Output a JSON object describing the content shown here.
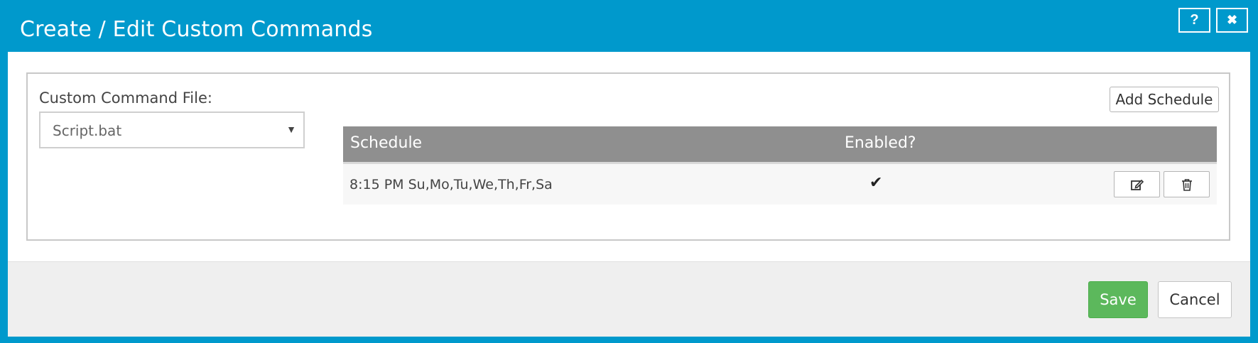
{
  "dialog": {
    "title": "Create / Edit Custom Commands",
    "help_icon": "question-icon",
    "help_glyph": "?",
    "close_icon": "close-icon",
    "close_glyph": "✖"
  },
  "file": {
    "label": "Custom Command File:",
    "selected": "Script.bat",
    "arrow_glyph": "▼"
  },
  "schedules": {
    "add_label": "Add Schedule",
    "headers": {
      "schedule": "Schedule",
      "enabled": "Enabled?"
    },
    "rows": [
      {
        "schedule": "8:15 PM Su,Mo,Tu,We,Th,Fr,Sa",
        "enabled_glyph": "✔",
        "edit_icon": "edit-icon",
        "delete_icon": "trash-icon"
      }
    ]
  },
  "footer": {
    "save_label": "Save",
    "cancel_label": "Cancel"
  },
  "colors": {
    "header_bg": "#0099cc",
    "table_header_bg": "#8f8f8f",
    "save_bg": "#5cb85c"
  }
}
